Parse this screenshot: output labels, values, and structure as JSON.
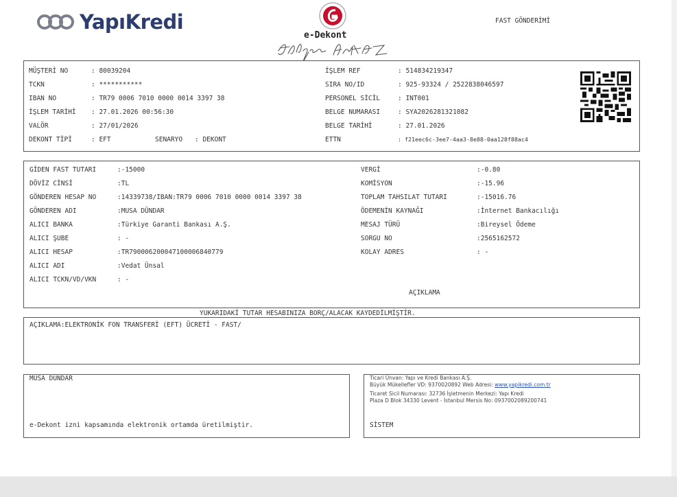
{
  "brand": {
    "name": "YapıKredi"
  },
  "header": {
    "doc_title": "e-Dekont",
    "page_title": "FAST GÖNDERİMİ"
  },
  "info": [
    {
      "label": "MÜŞTERİ NO",
      "value": ": 80039204"
    },
    {
      "label": "TCKN",
      "value": ": ***********"
    },
    {
      "label": "IBAN NO",
      "value": ": TR79 0006 7010 0000 0014 3397 38"
    },
    {
      "label": "İŞLEM TARİHİ",
      "value": ": 27.01.2026 00:56:30"
    },
    {
      "label": "VALÖR",
      "value": ": 27/01/2026"
    },
    {
      "label": "DEKONT TİPİ",
      "value": ": EFT"
    }
  ],
  "senaryo": {
    "label": "SENARYO",
    "value": ": DEKONT"
  },
  "info_right": [
    {
      "label": "İŞLEM REF",
      "value": ": 514834219347"
    },
    {
      "label": "SIRA NO/ID",
      "value": ": 925-93324 / 2522838046597"
    },
    {
      "label": "PERSONEL SİCİL",
      "value": ": INT001"
    },
    {
      "label": "BELGE NUMARASI",
      "value": ": SYA2026281321082"
    },
    {
      "label": "BELGE TARİHİ",
      "value": ": 27.01.2026"
    },
    {
      "label": "ETTN",
      "value": ": f21eec6c-3ee7-4aa3-8e88-0aa128f88ac4"
    }
  ],
  "details_left": [
    {
      "label": "GİDEN FAST TUTARI",
      "value": ":-15000"
    },
    {
      "label": "DÖVİZ CİNSİ",
      "value": ":TL"
    },
    {
      "label": "GÖNDEREN HESAP NO",
      "value": ":14339738/IBAN:TR79 0006 7010 0000 0014 3397 38"
    },
    {
      "label": "GÖNDEREN ADI",
      "value": ":MUSA DÜNDAR"
    },
    {
      "label": "ALICI BANKA",
      "value": ":Türkiye Garanti Bankası A.Ş."
    },
    {
      "label": "ALICI ŞUBE",
      "value": ": -"
    },
    {
      "label": "ALICI HESAP",
      "value": ":TR790006200047100006840779"
    },
    {
      "label": "ALICI ADI",
      "value": ":Vedat Ünsal"
    },
    {
      "label": "ALICI TCKN/VD/VKN",
      "value": ": -"
    }
  ],
  "details_right": [
    {
      "label": "VERGİ",
      "value": ":-0.80"
    },
    {
      "label": "KOMİSYON",
      "value": ":-15.96"
    },
    {
      "label": "TOPLAM TAHSILAT TUTARI",
      "value": ":-15016.76"
    },
    {
      "label": "ÖDEMENİN KAYNAĞI",
      "value": ":İnternet Bankacılığı"
    },
    {
      "label": "MESAJ TÜRÜ",
      "value": ":Bireysel Ödeme"
    },
    {
      "label": "SORGU NO",
      "value": ":2565162572"
    },
    {
      "label": "KOLAY ADRES",
      "value": ": -"
    }
  ],
  "aciklama_heading": "AÇIKLAMA",
  "notice": "YUKARIDAKİ TUTAR HESABINIZA BORÇ/ALACAK KAYDEDİLMİŞTİR.",
  "description": "AÇIKLAMA:ELEKTRONİK FON TRANSFERİ (EFT) ÜCRETİ - FAST/",
  "footer_left": {
    "name": "MUSA DÜNDAR",
    "note": "e-Dekont izni kapsamında elektronik ortamda üretilmiştir."
  },
  "footer_right": {
    "line1": "Ticari Ünvan: Yapı ve Kredi Bankası A.Ş.",
    "line2_prefix": "Büyük Mükellefler VD: 9370020892 Web Adresi: ",
    "line2_link": "www.yapikredi.com.tr",
    "line3": "Ticaret Sicil Numarası: 32736 İşletmenin Merkezi: Yapı Kredi",
    "line4": "Plaza D Blok 34330 Levent - İstanbul Mersis No: 0937002089200741",
    "system": "SİSTEM"
  },
  "colors": {
    "brand_navy": "#2d3e6e",
    "seal_red": "#c8102e",
    "link_blue": "#2a4fb0"
  }
}
